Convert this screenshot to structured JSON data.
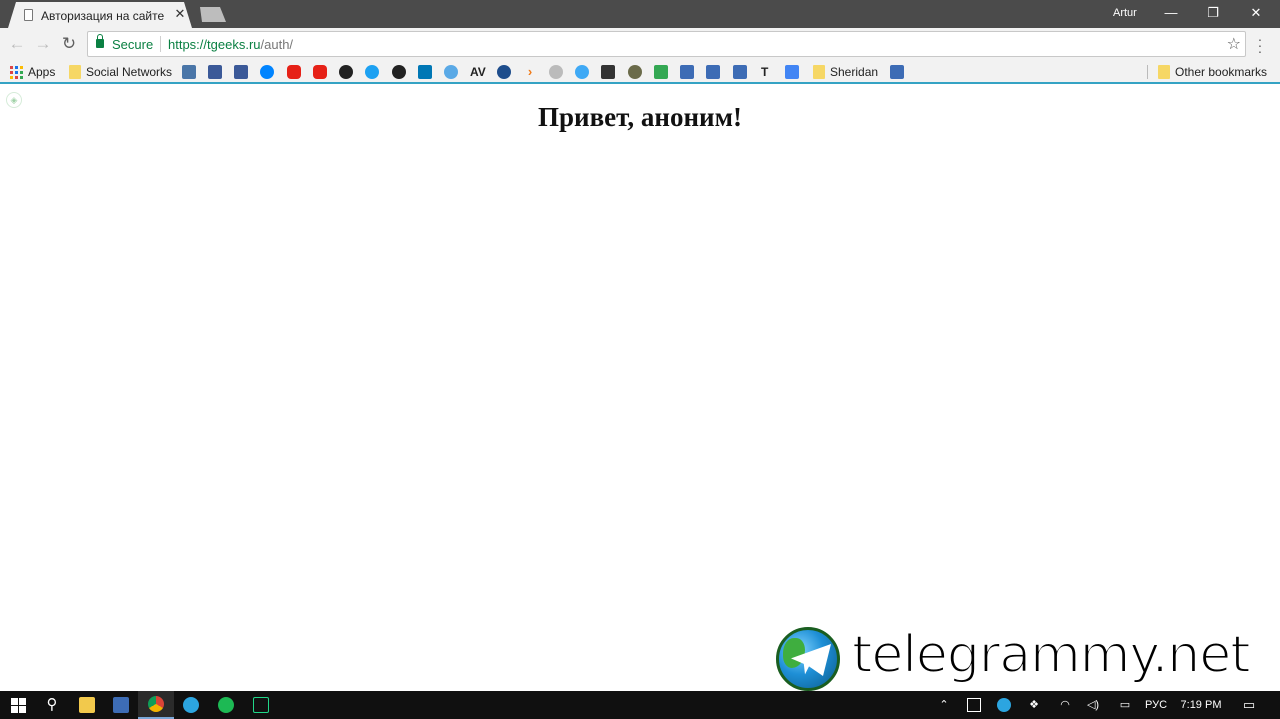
{
  "browser": {
    "tab": {
      "title": "Авторизация на сайте",
      "close": "✕"
    },
    "user": "Artur",
    "window_controls": {
      "minimize": "—",
      "restore": "❐",
      "close": "✕"
    },
    "nav": {
      "back": "←",
      "forward": "→",
      "reload": "↻"
    },
    "omnibox": {
      "secure_label": "Secure",
      "url_scheme": "https://",
      "url_host": "tgeeks.ru",
      "url_path": "/auth/"
    },
    "bookmarks": {
      "apps": "Apps",
      "social_networks": "Social Networks",
      "av": "AV",
      "t": "T",
      "sheridan": "Sheridan",
      "other": "Other bookmarks"
    }
  },
  "page": {
    "heading": "Привет, аноним!"
  },
  "watermark": {
    "text": "telegrammy.net"
  },
  "taskbar": {
    "lang": "РУС",
    "time": "7:19 PM"
  },
  "colors": {
    "secure_green": "#0b8043",
    "accent_line": "#35a3c4",
    "taskbar": "#101010"
  }
}
